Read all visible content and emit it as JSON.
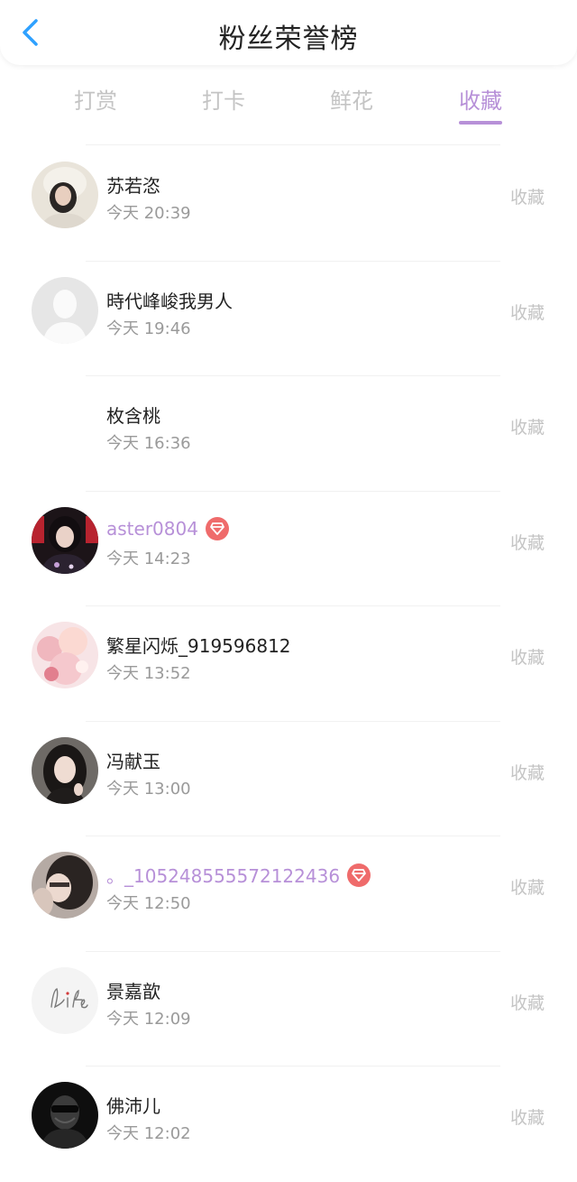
{
  "header": {
    "title": "粉丝荣誉榜",
    "back_icon": "chevron-left-icon",
    "accent_color": "#2fa1ff"
  },
  "tabs": [
    {
      "label": "打赏",
      "active": false
    },
    {
      "label": "打卡",
      "active": false
    },
    {
      "label": "鲜花",
      "active": false
    },
    {
      "label": "收藏",
      "active": true
    }
  ],
  "colors": {
    "active_tab": "#b790d8",
    "vip_name": "#b790d8",
    "badge": "#ef6b6b",
    "muted": "#c4c4c4"
  },
  "entries": [
    {
      "name": "苏若恣",
      "time": "今天 20:39",
      "action": "收藏",
      "vip": false,
      "avatar": "photo"
    },
    {
      "name": "時代峰峻我男人",
      "time": "今天 19:46",
      "action": "收藏",
      "vip": false,
      "avatar": "default-silhouette"
    },
    {
      "name": "枚含桃",
      "time": "今天 16:36",
      "action": "收藏",
      "vip": false,
      "avatar": "blank"
    },
    {
      "name": "aster0804",
      "time": "今天 14:23",
      "action": "收藏",
      "vip": true,
      "avatar": "photo"
    },
    {
      "name": "繁星闪烁_919596812",
      "time": "今天 13:52",
      "action": "收藏",
      "vip": false,
      "avatar": "photo"
    },
    {
      "name": "冯献玉",
      "time": "今天 13:00",
      "action": "收藏",
      "vip": false,
      "avatar": "photo"
    },
    {
      "name": "。_105248555572122436",
      "time": "今天 12:50",
      "action": "收藏",
      "vip": true,
      "avatar": "photo"
    },
    {
      "name": "景嘉歆",
      "time": "今天 12:09",
      "action": "收藏",
      "vip": false,
      "avatar": "life-logo"
    },
    {
      "name": "佛沛儿",
      "time": "今天 12:02",
      "action": "收藏",
      "vip": false,
      "avatar": "photo"
    }
  ]
}
